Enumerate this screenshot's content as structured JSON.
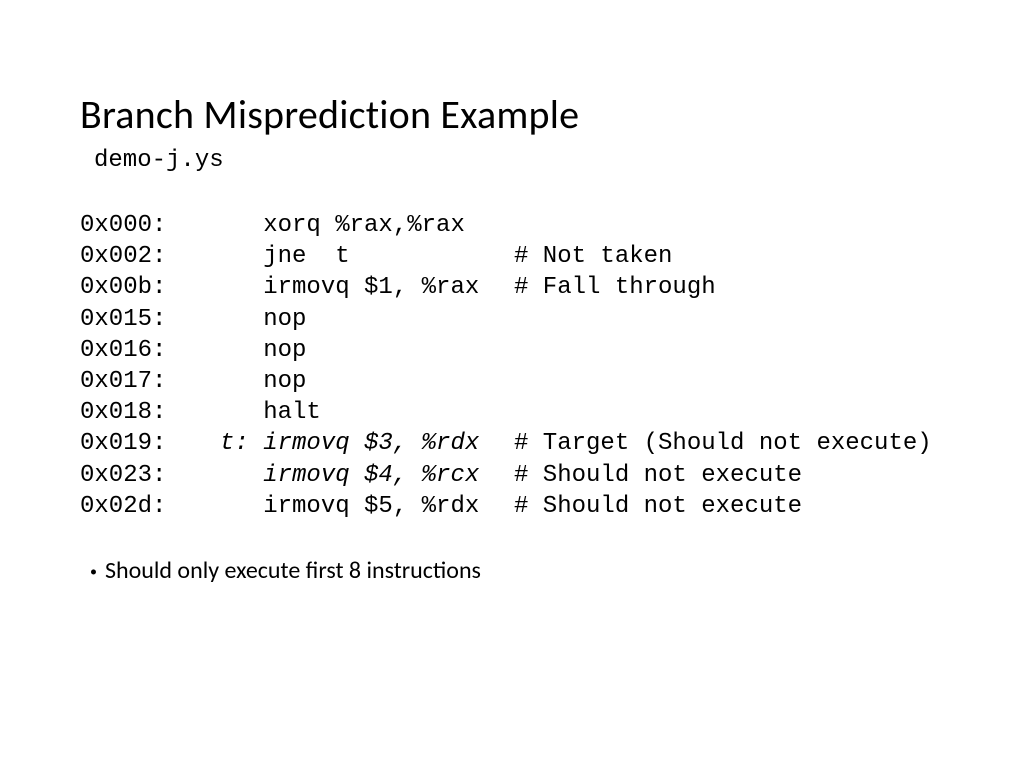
{
  "title": "Branch Misprediction Example",
  "filename": "demo-j.ys",
  "code": {
    "lines": [
      {
        "addr": "0x000:",
        "instr": "   xorq %rax,%rax",
        "comment": "",
        "italic": false
      },
      {
        "addr": "0x002:",
        "instr": "   jne  t",
        "comment": "# Not taken",
        "italic": false
      },
      {
        "addr": "0x00b:",
        "instr": "   irmovq $1, %rax",
        "comment": "# Fall through",
        "italic": false
      },
      {
        "addr": "0x015:",
        "instr": "   nop",
        "comment": "",
        "italic": false
      },
      {
        "addr": "0x016:",
        "instr": "   nop",
        "comment": "",
        "italic": false
      },
      {
        "addr": "0x017:",
        "instr": "   nop",
        "comment": "",
        "italic": false
      },
      {
        "addr": "0x018:",
        "instr": "   halt",
        "comment": "",
        "italic": false
      },
      {
        "addr": "0x019:",
        "instr": "t: irmovq $3, %rdx",
        "comment": "# Target (Should not execute)",
        "italic": true
      },
      {
        "addr": "0x023:",
        "instr": "   irmovq $4, %rcx",
        "comment": "# Should not execute",
        "italic": true
      },
      {
        "addr": "0x02d:",
        "instr": "   irmovq $5, %rdx",
        "comment": "# Should not execute",
        "italic": false
      }
    ]
  },
  "bullet": "Should only execute first 8 instructions"
}
